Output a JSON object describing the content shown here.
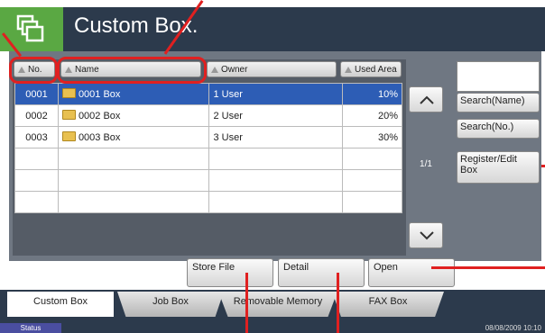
{
  "header": {
    "title": "Custom Box.",
    "icon": "multi-window-icon"
  },
  "columns": {
    "no": "No.",
    "name": "Name",
    "owner": "Owner",
    "area": "Used Area"
  },
  "rows": [
    {
      "no": "0001",
      "name": "0001 Box",
      "owner": "1 User",
      "area": "10%"
    },
    {
      "no": "0002",
      "name": "0002 Box",
      "owner": "2 User",
      "area": "20%"
    },
    {
      "no": "0003",
      "name": "0003 Box",
      "owner": "3 User",
      "area": "30%"
    }
  ],
  "pager": {
    "indicator": "1/1"
  },
  "side": {
    "search_name": "Search(Name)",
    "search_no": "Search(No.)",
    "register_edit": "Register/Edit Box"
  },
  "actions": {
    "store_file": "Store File",
    "detail": "Detail",
    "open": "Open"
  },
  "tabs": {
    "custom_box": "Custom Box",
    "job_box": "Job Box",
    "removable": "Removable Memory",
    "fax_box": "FAX Box"
  },
  "status": {
    "label": "Status",
    "datetime": "08/08/2009   10:10"
  },
  "colors": {
    "header_bg": "#2c3a4c",
    "accent_green": "#5aa843",
    "selection": "#2d5db5",
    "annotation": "#e02020"
  }
}
